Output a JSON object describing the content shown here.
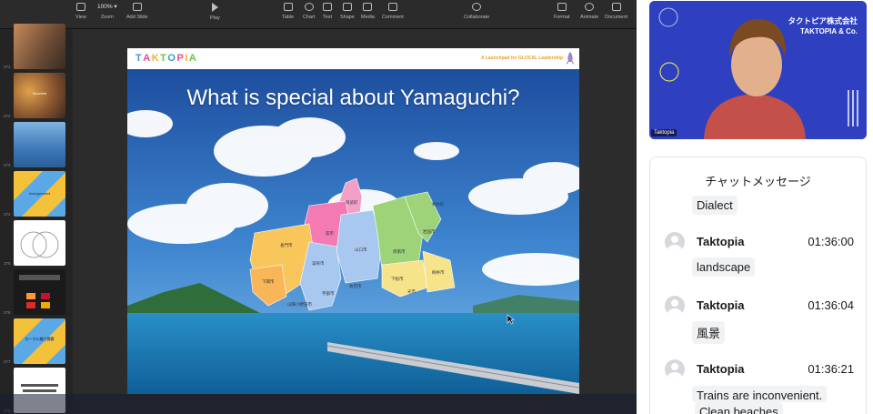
{
  "toolbar": {
    "items": [
      {
        "label": "View",
        "icon": "sidebar-view-icon"
      },
      {
        "label": "Zoom",
        "value": "100%",
        "icon": "zoom-dropdown"
      },
      {
        "label": "Add Slide",
        "icon": "add-slide-icon"
      },
      {
        "label": "Play",
        "icon": "play-icon"
      },
      {
        "label": "Table",
        "icon": "table-icon"
      },
      {
        "label": "Chart",
        "icon": "chart-icon"
      },
      {
        "label": "Text",
        "icon": "text-icon"
      },
      {
        "label": "Shape",
        "icon": "shape-icon"
      },
      {
        "label": "Media",
        "icon": "media-icon"
      },
      {
        "label": "Comment",
        "icon": "comment-icon"
      },
      {
        "label": "Collaborate",
        "icon": "collaborate-icon"
      },
      {
        "label": "Format",
        "icon": "format-brush-icon"
      },
      {
        "label": "Animate",
        "icon": "animate-icon"
      },
      {
        "label": "Document",
        "icon": "document-icon"
      }
    ]
  },
  "navigator": {
    "slides": [
      {
        "number": "271"
      },
      {
        "number": "272",
        "caption": "Souvenir"
      },
      {
        "number": "273"
      },
      {
        "number": "274",
        "caption": "Assignment"
      },
      {
        "number": "275"
      },
      {
        "number": "276"
      },
      {
        "number": "277",
        "caption": "ローカル魅力探索"
      },
      {
        "number": "278"
      }
    ]
  },
  "slide": {
    "logo_letters": [
      {
        "ch": "T",
        "color": "#2e9fd8"
      },
      {
        "ch": "A",
        "color": "#e8488a"
      },
      {
        "ch": "K",
        "color": "#f0b323"
      },
      {
        "ch": "T",
        "color": "#6cc04a"
      },
      {
        "ch": "O",
        "color": "#2e9fd8"
      },
      {
        "ch": "P",
        "color": "#e8488a"
      },
      {
        "ch": "I",
        "color": "#f0b323"
      },
      {
        "ch": "A",
        "color": "#6cc04a"
      }
    ],
    "tagline": "A Launchpad for GLOCAL Leadership",
    "title": "What is special about Yamaguchi?",
    "prefecture_labels": [
      "阿武町",
      "萩市",
      "長門市",
      "美祢市",
      "山口市",
      "下関市",
      "宇部市",
      "山陽小野田市",
      "防府市",
      "周南市",
      "下松市",
      "光市",
      "岩国市",
      "和木町",
      "柳井市"
    ]
  },
  "video": {
    "company_jp": "タクトピア株式会社",
    "company_en": "TAKTOPIA & Co.",
    "participant_name": "Taktopia"
  },
  "chat": {
    "title": "チャットメッセージ",
    "messages": [
      {
        "text": "Dialect"
      },
      {
        "sender": "Taktopia",
        "time": "01:36:00",
        "text": "landscape"
      },
      {
        "sender": "Taktopia",
        "time": "01:36:04",
        "text": "風景"
      },
      {
        "sender": "Taktopia",
        "time": "01:36:21",
        "text": "Trains are inconvenient."
      },
      {
        "text": "Clean beaches"
      }
    ]
  }
}
